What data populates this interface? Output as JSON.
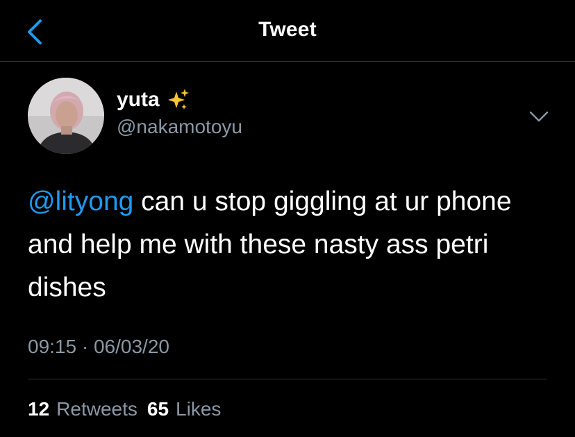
{
  "header": {
    "title": "Tweet",
    "back_icon": "chevron-left-icon",
    "accent": "#1d9bf0"
  },
  "author": {
    "name": "yuta",
    "emoji": "sparkles-icon",
    "handle": "@nakamotoyu"
  },
  "tweet": {
    "mention": "@lityong",
    "text": " can u stop giggling at ur phone and help me with these nasty ass petri dishes"
  },
  "meta": {
    "time": "09:15",
    "separator": " · ",
    "date": "06/03/20"
  },
  "stats": {
    "retweets_count": "12",
    "retweets_label": "Retweets",
    "likes_count": "65",
    "likes_label": "Likes"
  }
}
